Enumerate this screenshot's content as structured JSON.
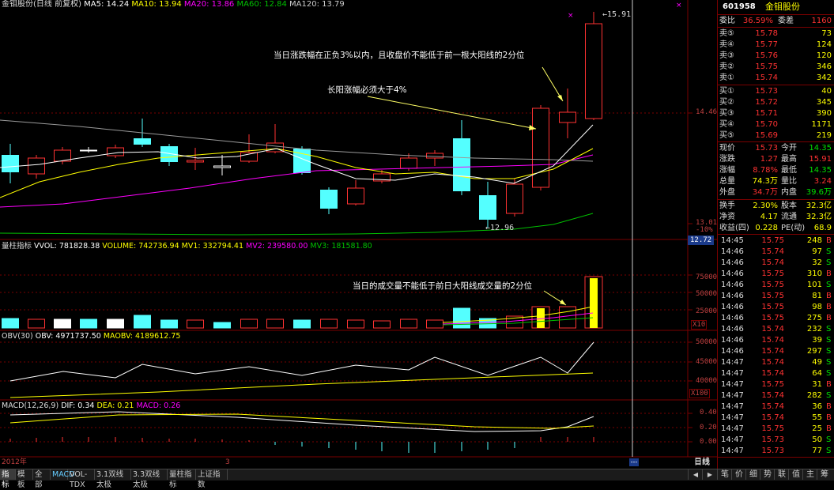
{
  "colors": {
    "up": "#ff3232",
    "down": "#54ffff",
    "ma5": "#ffffff",
    "ma10": "#ffff00",
    "ma20": "#ff00ff",
    "ma60": "#00c000",
    "ma120": "#9a9a9a",
    "grid": "#7a0000",
    "vol_hl": "#ffff00"
  },
  "main": {
    "title": "金钼股份(日线 前复权)",
    "ma_labels": [
      {
        "text": "MA5: 14.24",
        "color": "#ffffff"
      },
      {
        "text": "MA10: 13.94",
        "color": "#ffff00"
      },
      {
        "text": "MA20: 13.86",
        "color": "#ff00ff"
      },
      {
        "text": "MA60: 12.84",
        "color": "#00c000"
      },
      {
        "text": "MA120: 13.79",
        "color": "#cccccc"
      }
    ],
    "high_label": "15.91",
    "low_label": "12.96",
    "axis": {
      "top": "14.46",
      "bottom": "13.01",
      "bottom_pct": "-10%",
      "current": "12.72"
    },
    "note1": "当日涨跌幅在正负3%以内，且收盘价不能低于前一根大阳线的2分位",
    "note2": "长阳涨幅必须大于4%"
  },
  "vol": {
    "title": "量柱指标",
    "labels": [
      {
        "text": "VVOL: 781828.38",
        "color": "#ffffff"
      },
      {
        "text": "VOLUME: 742736.94",
        "color": "#ffff00"
      },
      {
        "text": "MV1: 332794.41",
        "color": "#ffff00"
      },
      {
        "text": "MV2: 239580.00",
        "color": "#ff00ff"
      },
      {
        "text": "MV3: 181581.80",
        "color": "#00c000"
      }
    ],
    "axis": [
      "75000",
      "50000",
      "25000"
    ],
    "unit": "X10",
    "note": "当日的成交量不能低于前日大阳线成交量的2分位"
  },
  "obv": {
    "title": "OBV(30)",
    "labels": [
      {
        "text": "OBV: 4971737.50",
        "color": "#ffffff"
      },
      {
        "text": "MAOBV: 4189612.75",
        "color": "#ffff00"
      }
    ],
    "axis": [
      "50000",
      "45000",
      "40000"
    ],
    "unit": "X100"
  },
  "macd": {
    "title": "MACD(12,26,9)",
    "labels": [
      {
        "text": "DIF: 0.34",
        "color": "#ffffff"
      },
      {
        "text": "DEA: 0.21",
        "color": "#ffff00"
      },
      {
        "text": "MACD: 0.26",
        "color": "#ff00ff"
      }
    ],
    "axis": [
      "0.40",
      "0.20",
      "0.00"
    ]
  },
  "time_axis": {
    "year": "2012年",
    "month": "3"
  },
  "right": {
    "code": "601958",
    "name": "金钼股份",
    "weibi": {
      "label": "委比",
      "value": "36.59%",
      "label2": "委差",
      "value2": "1160"
    },
    "asks": [
      {
        "label": "卖⑤",
        "price": "15.78",
        "vol": "73"
      },
      {
        "label": "卖④",
        "price": "15.77",
        "vol": "124"
      },
      {
        "label": "卖③",
        "price": "15.76",
        "vol": "120"
      },
      {
        "label": "卖②",
        "price": "15.75",
        "vol": "346"
      },
      {
        "label": "卖①",
        "price": "15.74",
        "vol": "342"
      }
    ],
    "bids": [
      {
        "label": "买①",
        "price": "15.73",
        "vol": "40"
      },
      {
        "label": "买②",
        "price": "15.72",
        "vol": "345"
      },
      {
        "label": "买③",
        "price": "15.71",
        "vol": "390"
      },
      {
        "label": "买④",
        "price": "15.70",
        "vol": "1171"
      },
      {
        "label": "买⑤",
        "price": "15.69",
        "vol": "219"
      }
    ],
    "stats": [
      {
        "l1": "现价",
        "v1": "15.73",
        "c1": "#ff3232",
        "l2": "今开",
        "v2": "14.35",
        "c2": "#00e000"
      },
      {
        "l1": "涨跌",
        "v1": "1.27",
        "c1": "#ff3232",
        "l2": "最高",
        "v2": "15.91",
        "c2": "#ff3232"
      },
      {
        "l1": "涨幅",
        "v1": "8.78%",
        "c1": "#ff3232",
        "l2": "最低",
        "v2": "14.35",
        "c2": "#00e000"
      },
      {
        "l1": "总量",
        "v1": "74.3万",
        "c1": "#ffff00",
        "l2": "量比",
        "v2": "3.24",
        "c2": "#ff3232"
      },
      {
        "l1": "外盘",
        "v1": "34.7万",
        "c1": "#ff3232",
        "l2": "内盘",
        "v2": "39.6万",
        "c2": "#00e000"
      }
    ],
    "stats2": [
      {
        "l1": "换手",
        "v1": "2.30%",
        "c1": "#ffff00",
        "l2": "股本",
        "v2": "32.3亿",
        "c2": "#ffff00"
      },
      {
        "l1": "净资",
        "v1": "4.17",
        "c1": "#ffff00",
        "l2": "流通",
        "v2": "32.3亿",
        "c2": "#ffff00"
      },
      {
        "l1": "收益(四)",
        "v1": "0.228",
        "c1": "#ffff00",
        "l2": "PE(动)",
        "v2": "68.9",
        "c2": "#ffff00"
      }
    ],
    "ticks": [
      {
        "t": "14:45",
        "p": "15.75",
        "v": "248",
        "s": "B"
      },
      {
        "t": "14:46",
        "p": "15.74",
        "v": "97",
        "s": "S"
      },
      {
        "t": "14:46",
        "p": "15.74",
        "v": "32",
        "s": "S"
      },
      {
        "t": "14:46",
        "p": "15.75",
        "v": "310",
        "s": "B"
      },
      {
        "t": "14:46",
        "p": "15.75",
        "v": "101",
        "s": "S"
      },
      {
        "t": "14:46",
        "p": "15.75",
        "v": "81",
        "s": "B"
      },
      {
        "t": "14:46",
        "p": "15.75",
        "v": "98",
        "s": "B"
      },
      {
        "t": "14:46",
        "p": "15.75",
        "v": "275",
        "s": "B"
      },
      {
        "t": "14:46",
        "p": "15.74",
        "v": "232",
        "s": "S"
      },
      {
        "t": "14:46",
        "p": "15.74",
        "v": "39",
        "s": "S"
      },
      {
        "t": "14:46",
        "p": "15.74",
        "v": "297",
        "s": "S"
      },
      {
        "t": "14:47",
        "p": "15.74",
        "v": "49",
        "s": "S"
      },
      {
        "t": "14:47",
        "p": "15.74",
        "v": "64",
        "s": "S"
      },
      {
        "t": "14:47",
        "p": "15.75",
        "v": "31",
        "s": "B"
      },
      {
        "t": "14:47",
        "p": "15.74",
        "v": "282",
        "s": "S"
      },
      {
        "t": "14:47",
        "p": "15.74",
        "v": "36",
        "s": "B"
      },
      {
        "t": "14:47",
        "p": "15.74",
        "v": "55",
        "s": "B"
      },
      {
        "t": "14:47",
        "p": "15.75",
        "v": "25",
        "s": "B"
      },
      {
        "t": "14:47",
        "p": "15.73",
        "v": "50",
        "s": "S"
      },
      {
        "t": "14:47",
        "p": "15.73",
        "v": "77",
        "s": "S"
      }
    ],
    "period": "日线"
  },
  "bottom_tabs": [
    "指标",
    "模板",
    "全部",
    "MACD",
    "VOL-TDX",
    "3.1双线太极",
    "3.3双线太极",
    "量柱指标",
    "上证指数"
  ],
  "bottom_icons": [
    "笔",
    "价",
    "细",
    "势",
    "联",
    "值",
    "主",
    "筹"
  ]
}
